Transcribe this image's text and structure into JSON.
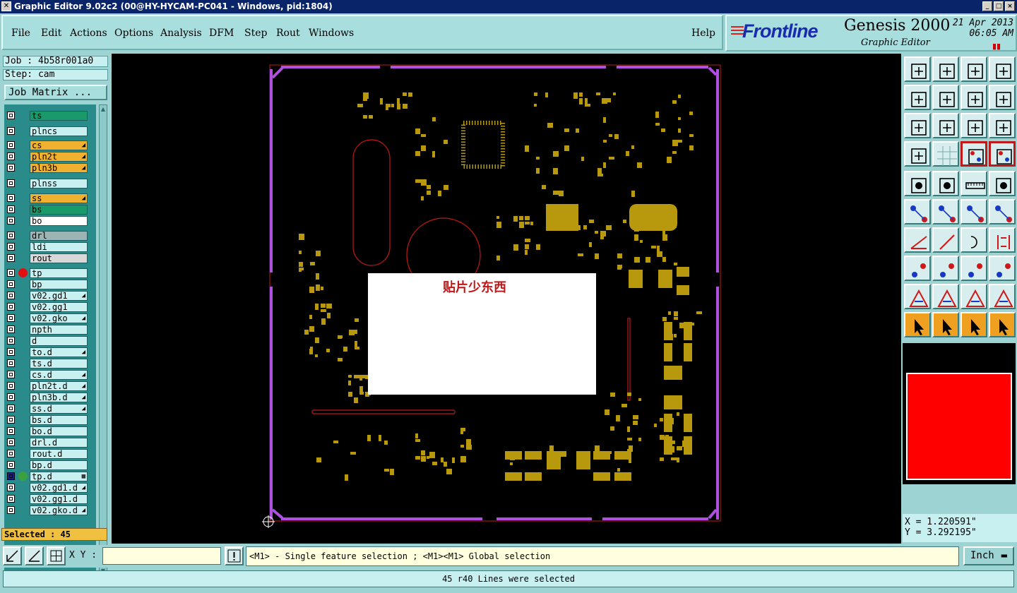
{
  "window": {
    "title": "Graphic Editor 9.02c2 (00@HY-HYCAM-PC041 - Windows, pid:1804)",
    "min": "_",
    "max": "□",
    "close": "×"
  },
  "menu": [
    "File",
    "Edit",
    "Actions",
    "Options",
    "Analysis",
    "DFM",
    "Step",
    "Rout",
    "Windows"
  ],
  "help": "Help",
  "brand": {
    "logo": "Frontline",
    "product": "Genesis 2000",
    "subtitle": "Graphic Editor",
    "date": "21 Apr 2013",
    "time": "06:05 AM",
    "pause_mark": "▮▮"
  },
  "job": {
    "label": "Job : 4b58r001a0",
    "step": "Step: cam",
    "matrix_button": "Job Matrix ..."
  },
  "layers": [
    {
      "name": "ts",
      "color": "#1a9a6a",
      "flag": ""
    },
    {
      "name": "plncs",
      "color": "#c8f0f0",
      "flag": ""
    },
    {
      "name": "cs",
      "color": "#f0b030",
      "flag": "◢"
    },
    {
      "name": "pln2t",
      "color": "#f0b030",
      "flag": "◢"
    },
    {
      "name": "pln3b",
      "color": "#f0b030",
      "flag": "◢"
    },
    {
      "name": "plnss",
      "color": "#c8f0f0",
      "flag": ""
    },
    {
      "name": "ss",
      "color": "#f0b030",
      "flag": "◢"
    },
    {
      "name": "bs",
      "color": "#1a9a6a",
      "flag": ""
    },
    {
      "name": "bo",
      "color": "#ffffff",
      "flag": ""
    },
    {
      "name": "drl",
      "color": "#9cb4b4",
      "flag": ""
    },
    {
      "name": "ldi",
      "color": "#c8f0f0",
      "flag": ""
    },
    {
      "name": "rout",
      "color": "#d8d8d8",
      "flag": ""
    },
    {
      "name": "tp",
      "color": "#c8f0f0",
      "flag": ""
    },
    {
      "name": "bp",
      "color": "#c8f0f0",
      "flag": ""
    },
    {
      "name": "v02.gd1",
      "color": "#c8f0f0",
      "flag": "◢"
    },
    {
      "name": "v02.gg1",
      "color": "#c8f0f0",
      "flag": ""
    },
    {
      "name": "v02.gko",
      "color": "#c8f0f0",
      "flag": "◢"
    },
    {
      "name": "npth",
      "color": "#c8f0f0",
      "flag": ""
    },
    {
      "name": "d",
      "color": "#c8f0f0",
      "flag": ""
    },
    {
      "name": "to.d",
      "color": "#c8f0f0",
      "flag": "◢"
    },
    {
      "name": "ts.d",
      "color": "#c8f0f0",
      "flag": ""
    },
    {
      "name": "cs.d",
      "color": "#c8f0f0",
      "flag": "◢"
    },
    {
      "name": "pln2t.d",
      "color": "#c8f0f0",
      "flag": "◢"
    },
    {
      "name": "pln3b.d",
      "color": "#c8f0f0",
      "flag": "◢"
    },
    {
      "name": "ss.d",
      "color": "#c8f0f0",
      "flag": "◢"
    },
    {
      "name": "bs.d",
      "color": "#c8f0f0",
      "flag": ""
    },
    {
      "name": "bo.d",
      "color": "#c8f0f0",
      "flag": ""
    },
    {
      "name": "drl.d",
      "color": "#c8f0f0",
      "flag": ""
    },
    {
      "name": "rout.d",
      "color": "#c8f0f0",
      "flag": ""
    },
    {
      "name": "bp.d",
      "color": "#c8f0f0",
      "flag": ""
    },
    {
      "name": "tp.d",
      "color": "#c8f0f0",
      "flag": "▦"
    },
    {
      "name": "v02.gd1.d",
      "color": "#c8f0f0",
      "flag": "◢"
    },
    {
      "name": "v02.gg1.d",
      "color": "#c8f0f0",
      "flag": ""
    },
    {
      "name": "v02.gko.d",
      "color": "#c8f0f0",
      "flag": "◢"
    }
  ],
  "selected": "Selected : 45",
  "canvas": {
    "overlay_note": "贴片少东西"
  },
  "coords": {
    "x": "X = 1.220591\"",
    "y": "Y = 3.292195\""
  },
  "bottom": {
    "xy_label": "X Y :",
    "xy_value": "",
    "message": "<M1> - Single feature selection ; <M1><M1> Global selection",
    "unit": "Inch",
    "status": "45 r40 Lines were selected"
  },
  "colors": {
    "pads": "#b8980c",
    "profile": "#b050e0",
    "rout": "#c01818",
    "board_bg": "#000000"
  }
}
